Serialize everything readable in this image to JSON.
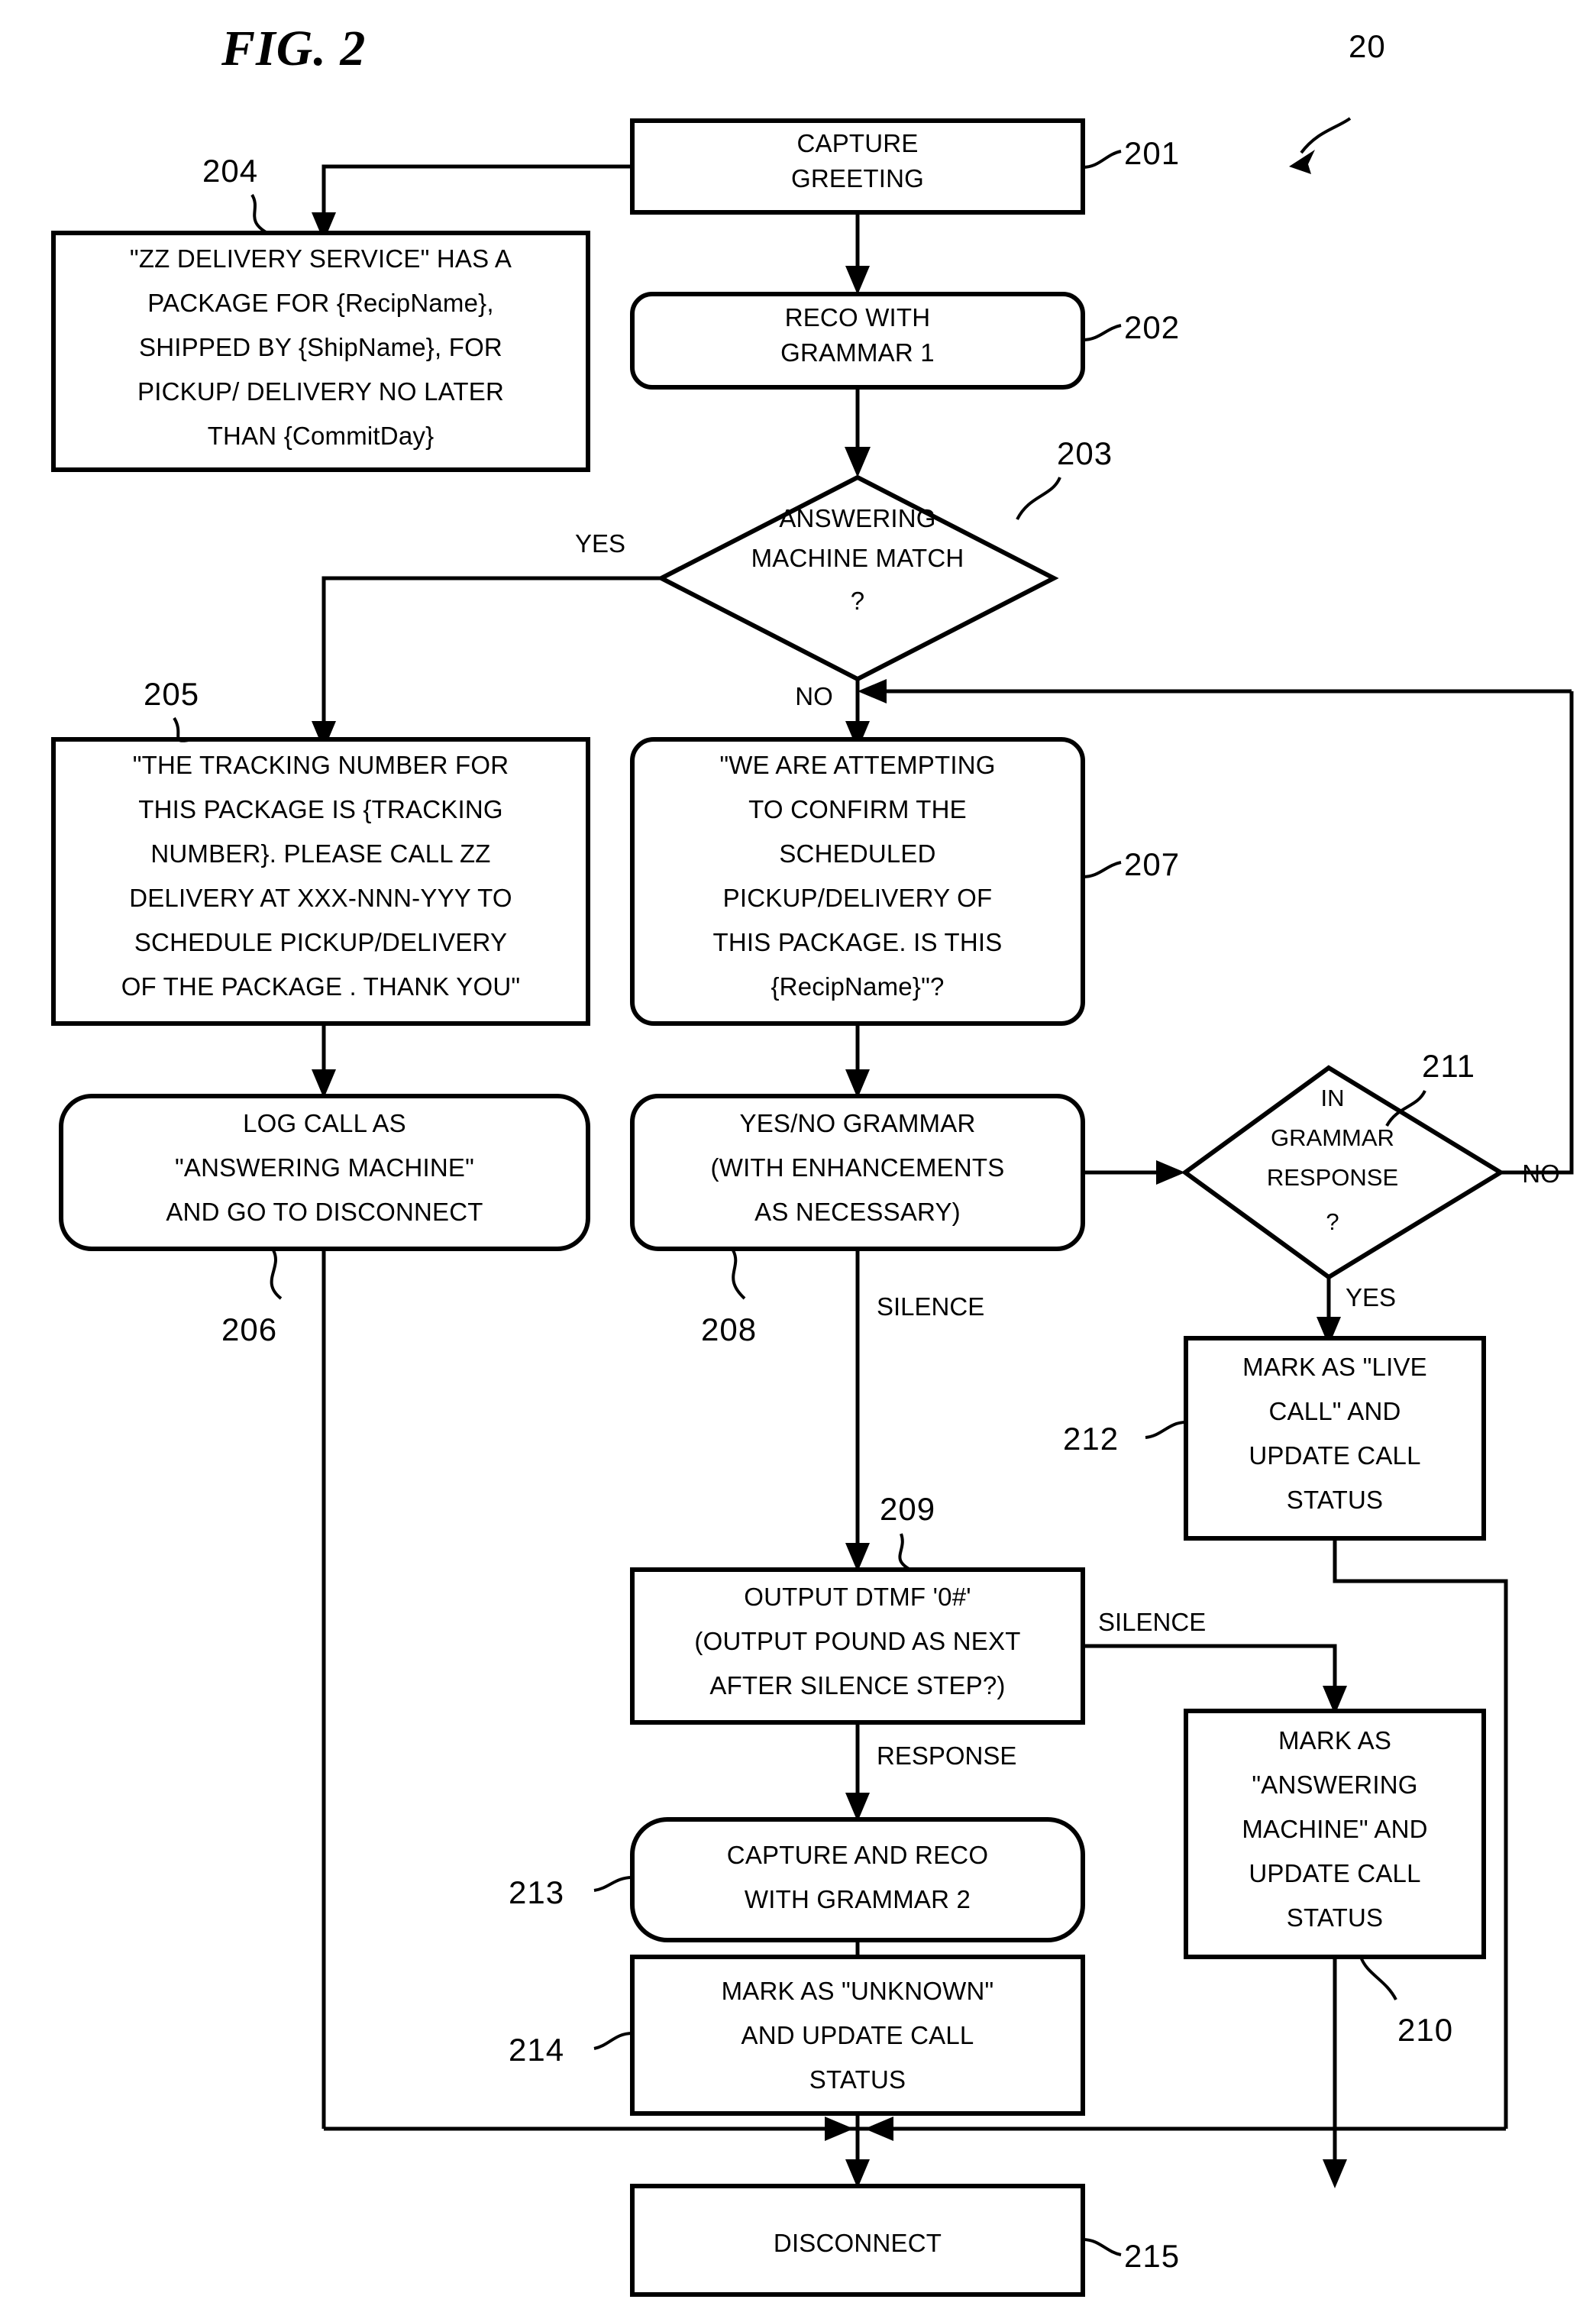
{
  "figure": {
    "title": "FIG. 2",
    "system_ref": "20"
  },
  "nodes": [
    {
      "ref": "201",
      "shape": "rect",
      "lines": [
        "CAPTURE",
        "GREETING"
      ]
    },
    {
      "ref": "202",
      "shape": "rounded",
      "lines": [
        "RECO WITH",
        "GRAMMAR 1"
      ]
    },
    {
      "ref": "203",
      "shape": "diamond",
      "lines": [
        "ANSWERING",
        "MACHINE MATCH",
        "?"
      ]
    },
    {
      "ref": "204",
      "shape": "rect",
      "lines": [
        "\"ZZ DELIVERY SERVICE\" HAS A",
        "PACKAGE FOR {RecipName},",
        "SHIPPED BY {ShipName}, FOR",
        "PICKUP/ DELIVERY NO LATER",
        "THAN {CommitDay}"
      ]
    },
    {
      "ref": "205",
      "shape": "rect",
      "lines": [
        "\"THE TRACKING NUMBER FOR",
        "THIS PACKAGE  IS {TRACKING",
        "NUMBER}. PLEASE CALL ZZ",
        "DELIVERY AT XXX-NNN-YYY TO",
        "SCHEDULE PICKUP/DELIVERY",
        "OF THE PACKAGE . THANK YOU\""
      ]
    },
    {
      "ref": "206",
      "shape": "rounded",
      "lines": [
        "LOG CALL AS",
        "\"ANSWERING MACHINE\"",
        "AND GO TO DISCONNECT"
      ]
    },
    {
      "ref": "207",
      "shape": "rounded",
      "lines": [
        "\"WE ARE ATTEMPTING",
        "TO CONFIRM THE",
        "SCHEDULED",
        "PICKUP/DELIVERY OF",
        "THIS PACKAGE. IS THIS",
        "{RecipName}\"?"
      ]
    },
    {
      "ref": "208",
      "shape": "rounded",
      "lines": [
        "YES/NO GRAMMAR",
        "(WITH ENHANCEMENTS",
        "AS NECESSARY)"
      ]
    },
    {
      "ref": "209",
      "shape": "rect",
      "lines": [
        "OUTPUT DTMF '0#'",
        "(OUTPUT POUND AS NEXT",
        "AFTER SILENCE STEP?)"
      ]
    },
    {
      "ref": "210",
      "shape": "rect",
      "lines": [
        "MARK AS",
        "\"ANSWERING",
        "MACHINE\" AND",
        "UPDATE CALL",
        "STATUS"
      ]
    },
    {
      "ref": "211",
      "shape": "diamond",
      "lines": [
        "IN",
        "GRAMMAR",
        "RESPONSE",
        "?"
      ]
    },
    {
      "ref": "212",
      "shape": "rect",
      "lines": [
        "MARK AS \"LIVE",
        "CALL\" AND",
        "UPDATE CALL",
        "STATUS"
      ]
    },
    {
      "ref": "213",
      "shape": "rounded",
      "lines": [
        "CAPTURE AND RECO",
        "WITH GRAMMAR 2"
      ]
    },
    {
      "ref": "214",
      "shape": "rect",
      "lines": [
        "MARK AS \"UNKNOWN\"",
        "AND UPDATE CALL",
        "STATUS"
      ]
    },
    {
      "ref": "215",
      "shape": "rect",
      "lines": [
        "DISCONNECT"
      ]
    }
  ],
  "edge_labels": {
    "am_yes": "YES",
    "am_no": "NO",
    "grammar_no": "NO",
    "grammar_yes": "YES",
    "silence_208": "SILENCE",
    "silence_209": "SILENCE",
    "response_209": "RESPONSE"
  }
}
